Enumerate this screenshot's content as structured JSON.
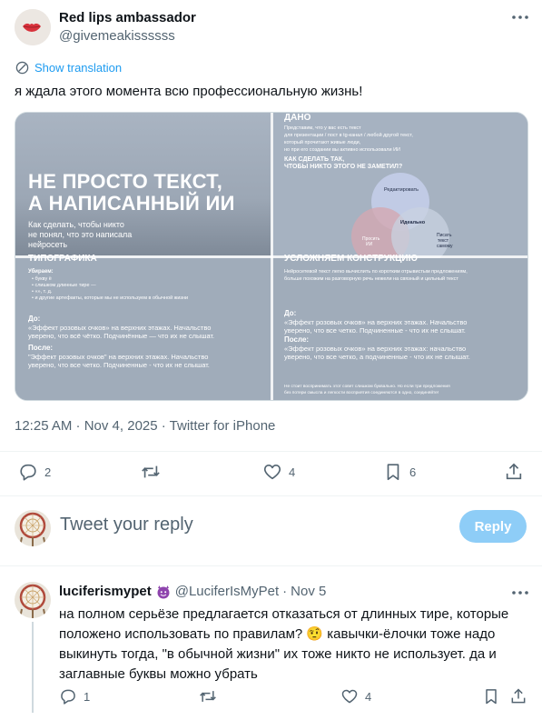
{
  "tweet": {
    "author_name": "Red lips ambassador",
    "author_handle": "@givemeakissssss",
    "translate_label": "Show translation",
    "text": "я ждала этого момента всю профессиональную жизнь!",
    "meta": "12:25 AM · Nov 4, 2025 · Twitter for iPhone",
    "stats": {
      "replies": "2",
      "likes": "4",
      "bookmarks": "6"
    }
  },
  "media": {
    "q1": {
      "title_line1": "НЕ ПРОСТО ТЕКСТ,",
      "title_line2": "А НАПИСАННЫЙ ИИ",
      "sub1": "Как сделать, чтобы никто",
      "sub2": "не понял, что это написала",
      "sub3": "нейросеть"
    },
    "q2": {
      "header": "ДАНО",
      "l1": "Представим, что у вас есть текст",
      "l2": "для презентации / пост в tg-канал / любой другой текст,",
      "l3": "который прочитают живые люди,",
      "l4": "но при его создании вы активно использовали ИИ",
      "q1": "КАК СДЕЛАТЬ ТАК,",
      "q2": "ЧТОБЫ НИКТО ЭТОГО НЕ ЗАМЕТИЛ?",
      "v_top": "Редактировать",
      "v_center": "Идеально",
      "v_left1": "Просить",
      "v_left2": "ИИ",
      "v_right1": "Писать",
      "v_right2": "текст",
      "v_right3": "самому"
    },
    "q3": {
      "header": "ТИПОГРАФИКА",
      "remove": "Убираем:",
      "b1": "• букву ё",
      "b2": "• слишком длинные тире —",
      "b3": "• «», т. д.",
      "b4": "• и другие артефакты, которые мы не используем в обычной жизни",
      "before": "До:",
      "before_t1": "«Эффект розовых очков» на верхних этажах. Начальство",
      "before_t2": "уверено, что всё чётко. Подчинённые — что их не слышат.",
      "after": "После:",
      "after_t1": "\"Эффект розовых очков\" на верхних этажах. Начальство",
      "after_t2": "уверено, что все четко. Подчиненные - что их не слышат."
    },
    "q4": {
      "header": "УСЛОЖНЯЕМ КОНСТРУКЦИЮ",
      "l1": "Нейросетевой текст легко вычислить по коротким отрывистым предложениям,",
      "l2": "больше похожим на разговорную речь нежели на связный и цельный текст",
      "before": "До:",
      "before_t1": "«Эффект розовых очков» на верхних этажах. Начальство",
      "before_t2": "уверено, что все четко. Подчиненные - что их не слышат.",
      "after": "После:",
      "after_t1": "«Эффект розовых очков» на верхних этажах: начальство",
      "after_t2": "уверено, что все четко, а подчиненные - что их не слышат.",
      "foot1": "Не стоит воспринимать этот совет слишком буквально. Но если три предложения",
      "foot2": "без потери смысла и легкости восприятия соединяются в одно, соединяйте!"
    }
  },
  "reply_box": {
    "placeholder": "Tweet your reply",
    "button_label": "Reply"
  },
  "comment": {
    "author_name": "luciferismypet",
    "author_handle": "@LuciferIsMyPet",
    "dot": "·",
    "time": "Nov 5",
    "line1": "на полном серьёзе предлагается отказаться от длинных тире, которые",
    "line2": "положено использовать по правилам? 🤨 кавычки-ёлочки тоже надо",
    "line3": "выкинуть тогда, \"в обычной жизни\" их тоже никто не использует. да и",
    "line4": "заглавные буквы можно убрать",
    "stats": {
      "replies": "1",
      "likes": "4"
    }
  },
  "colors": {
    "accent": "#1d9bf0",
    "muted": "#536471",
    "reply_button": "#8ecdf7",
    "media_bg": "#a0acba"
  },
  "icons": [
    "more-icon",
    "translate-icon",
    "reply-icon",
    "retweet-icon",
    "like-icon",
    "bookmark-icon",
    "share-icon",
    "devil-emoji-icon"
  ]
}
